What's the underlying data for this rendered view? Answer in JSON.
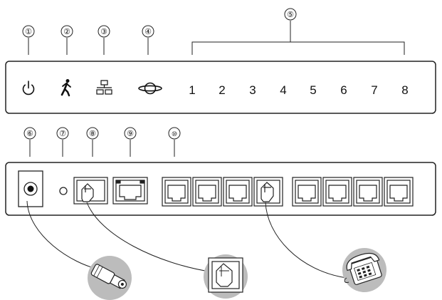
{
  "front_panel": {
    "callouts": [
      "①",
      "②",
      "③",
      "④",
      "⑤"
    ],
    "led_icons": [
      "power-icon",
      "walking-person-icon",
      "network-icon",
      "internet-globe-icon"
    ],
    "port_numbers": [
      "1",
      "2",
      "3",
      "4",
      "5",
      "6",
      "7",
      "8"
    ]
  },
  "rear_panel": {
    "callouts": [
      "⑥",
      "⑦",
      "⑧",
      "⑨",
      "⑩"
    ],
    "components": [
      "dc-power-jack",
      "reset-hole",
      "rj11-port-plugged",
      "rj45-ethernet-port",
      "rj11-extension-ports"
    ]
  },
  "peripherals": [
    "power-plug-icon",
    "phone-line-jack-icon",
    "telephone-icon"
  ]
}
